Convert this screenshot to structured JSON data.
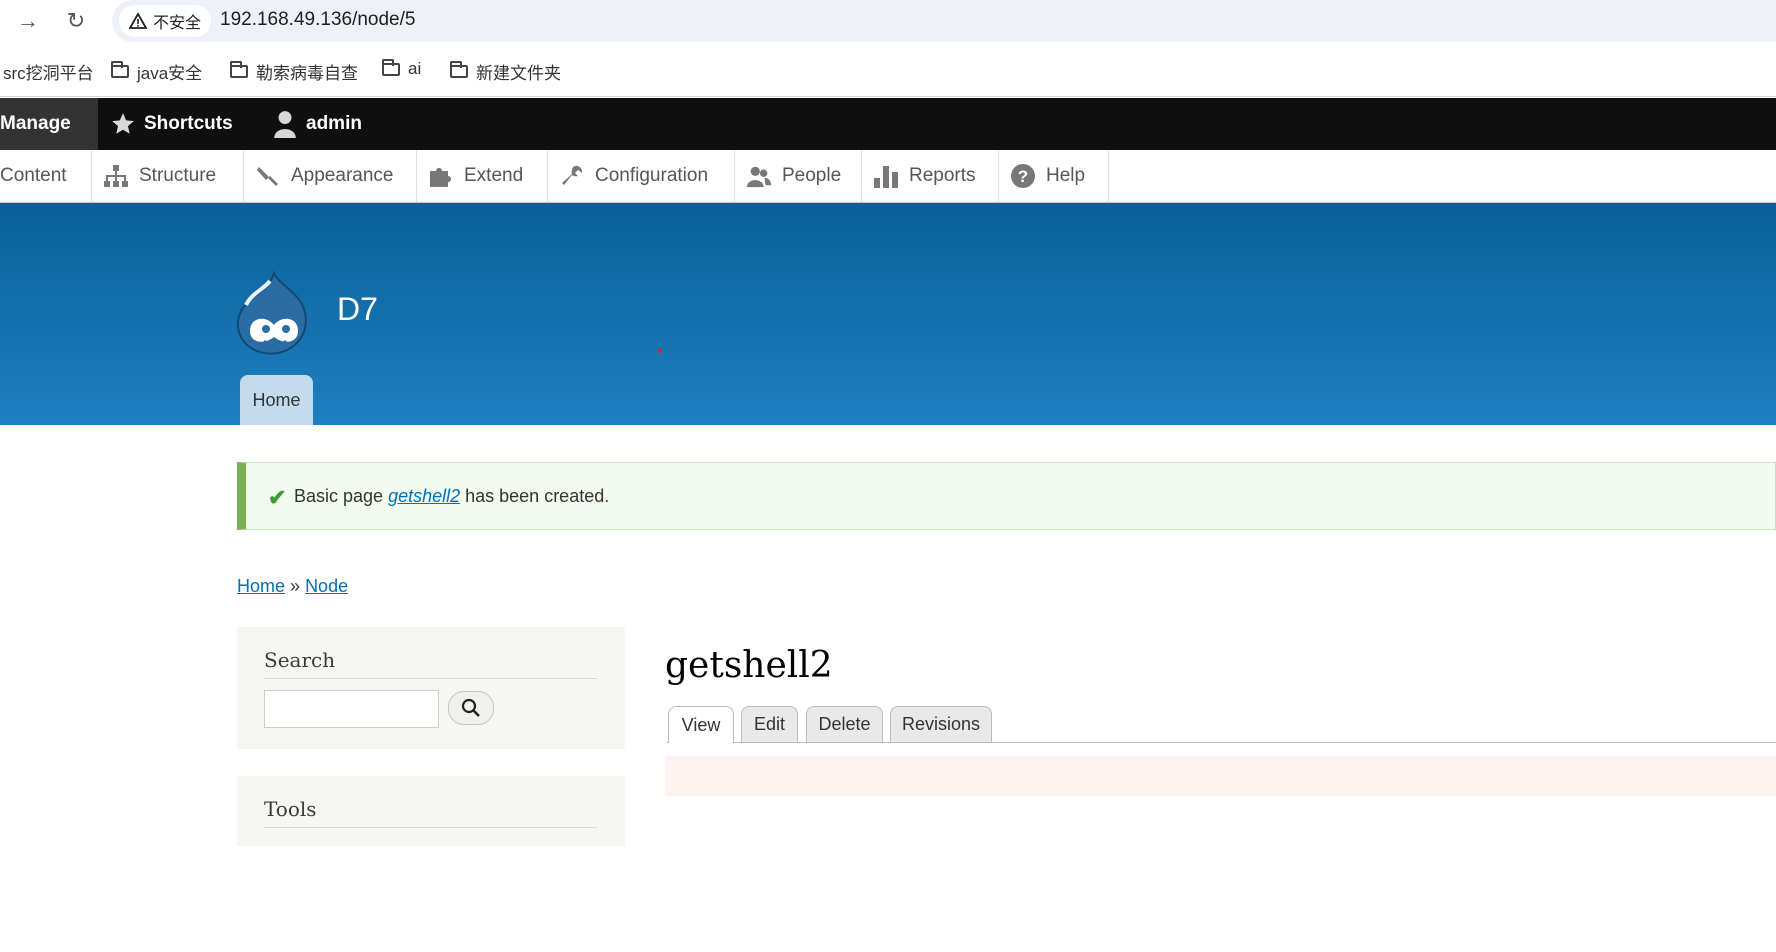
{
  "browser": {
    "back_glyph": "→",
    "reload_glyph": "↻",
    "security_label": "不安全",
    "url": "192.168.49.136/node/5",
    "bookmarks": [
      "src挖洞平台",
      "java安全",
      "勒索病毒自查",
      "ai",
      "新建文件夹"
    ]
  },
  "toolbar": {
    "manage": "Manage",
    "shortcuts": "Shortcuts",
    "user": "admin"
  },
  "tray": {
    "items": [
      "Content",
      "Structure",
      "Appearance",
      "Extend",
      "Configuration",
      "People",
      "Reports",
      "Help"
    ]
  },
  "header": {
    "site_name": "D7",
    "home_tab": "Home"
  },
  "message": {
    "prefix": "Basic page ",
    "link": "getshell2",
    "suffix": " has been created."
  },
  "breadcrumb": {
    "home": "Home",
    "separator": "»",
    "node": "Node"
  },
  "sidebar": {
    "search_title": "Search",
    "tools_title": "Tools"
  },
  "main": {
    "title": "getshell2",
    "tabs": [
      "View",
      "Edit",
      "Delete",
      "Revisions"
    ]
  },
  "colors": {
    "header_top": "#0a5f97",
    "header_bottom": "#1e80c0",
    "link": "#0071b3",
    "message_border": "#77b259"
  }
}
